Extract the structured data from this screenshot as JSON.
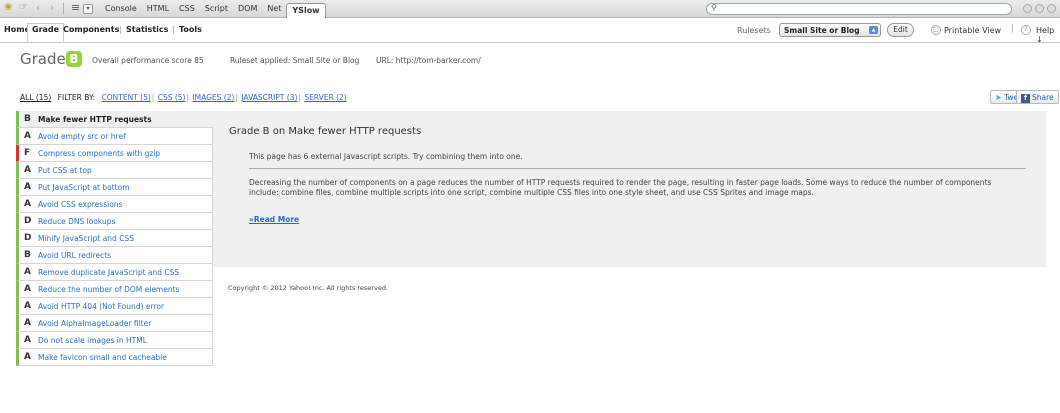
{
  "firebug": {
    "tabs": [
      "Console",
      "HTML",
      "CSS",
      "Script",
      "DOM",
      "Net",
      "YSlow"
    ],
    "active_tab": "YSlow"
  },
  "yslow_tabs": [
    "Home",
    "Grade",
    "Components",
    "Statistics",
    "Tools"
  ],
  "toolbar_right": {
    "rulesets_label": "Rulesets",
    "ruleset_value": "Small Site or Blog",
    "edit_label": "Edit",
    "printable_label": "Printable View",
    "help_label": "Help ↓"
  },
  "grade": {
    "title": "Grade",
    "letter": "B",
    "score_text": "Overall performance score 85",
    "ruleset_text": "Ruleset applied: Small Site or Blog",
    "url_text": "URL: http://tom-barker.com/"
  },
  "filter": {
    "all": "ALL (15)",
    "label": "FILTER BY:",
    "links": [
      "CONTENT (5)",
      "CSS (5)",
      "IMAGES (2)",
      "JAVASCRIPT (3)",
      "SERVER (2)"
    ]
  },
  "share": {
    "tweet": "Tweet",
    "share": "Share"
  },
  "rules": [
    {
      "grade": "B",
      "name": "Make fewer HTTP requests"
    },
    {
      "grade": "A",
      "name": "Avoid empty src or href"
    },
    {
      "grade": "F",
      "name": "Compress components with gzip"
    },
    {
      "grade": "A",
      "name": "Put CSS at top"
    },
    {
      "grade": "A",
      "name": "Put JavaScript at bottom"
    },
    {
      "grade": "A",
      "name": "Avoid CSS expressions"
    },
    {
      "grade": "D",
      "name": "Reduce DNS lookups"
    },
    {
      "grade": "D",
      "name": "Minify JavaScript and CSS"
    },
    {
      "grade": "B",
      "name": "Avoid URL redirects"
    },
    {
      "grade": "A",
      "name": "Remove duplicate JavaScript and CSS"
    },
    {
      "grade": "A",
      "name": "Reduce the number of DOM elements"
    },
    {
      "grade": "A",
      "name": "Avoid HTTP 404 (Not Found) error"
    },
    {
      "grade": "A",
      "name": "Avoid AlphaImageLoader filter"
    },
    {
      "grade": "A",
      "name": "Do not scale images in HTML"
    },
    {
      "grade": "A",
      "name": "Make favicon small and cacheable"
    }
  ],
  "detail": {
    "title": "Grade B on Make fewer HTTP requests",
    "finding": "This page has 6 external Javascript scripts. Try combining them into one.",
    "description": "Decreasing the number of components on a page reduces the number of HTTP requests required to render the page, resulting in faster page loads. Some ways to reduce the number of components include: combine files, combine multiple scripts into one script, combine multiple CSS files into one style sheet, and use CSS Sprites and image maps.",
    "read_more": "»Read More"
  },
  "copyright": "Copyright © 2012 Yahoo! Inc. All rights reserved."
}
